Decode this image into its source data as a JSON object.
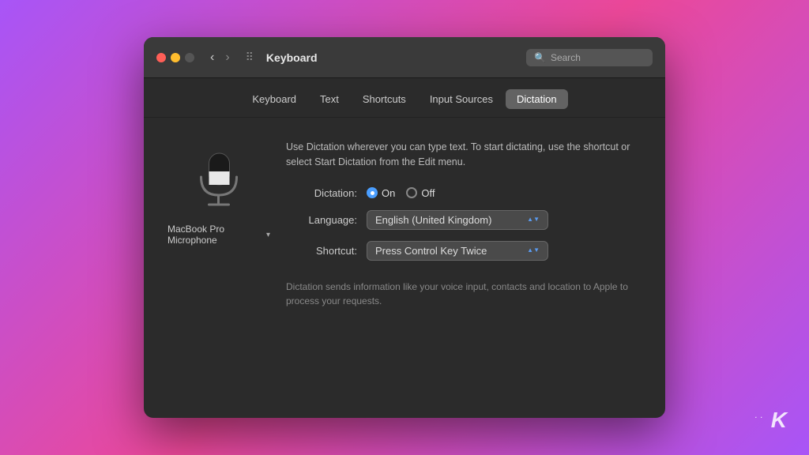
{
  "window": {
    "title": "Keyboard"
  },
  "titlebar": {
    "search_placeholder": "Search",
    "back_arrow": "‹",
    "forward_arrow": "›"
  },
  "tabs": [
    {
      "id": "keyboard",
      "label": "Keyboard",
      "active": false
    },
    {
      "id": "text",
      "label": "Text",
      "active": false
    },
    {
      "id": "shortcuts",
      "label": "Shortcuts",
      "active": false
    },
    {
      "id": "input-sources",
      "label": "Input Sources",
      "active": false
    },
    {
      "id": "dictation",
      "label": "Dictation",
      "active": true
    }
  ],
  "dictation": {
    "description": "Use Dictation wherever you can type text. To start dictating, use the shortcut or select Start Dictation from the Edit menu.",
    "mic_label": "MacBook Pro Microphone",
    "dictation_label": "Dictation:",
    "on_label": "On",
    "off_label": "Off",
    "language_label": "Language:",
    "language_value": "English (United Kingdom)",
    "shortcut_label": "Shortcut:",
    "shortcut_value": "Press Control Key Twice",
    "privacy_text": "Dictation sends information like your voice input, contacts and location to Apple to process your requests."
  }
}
